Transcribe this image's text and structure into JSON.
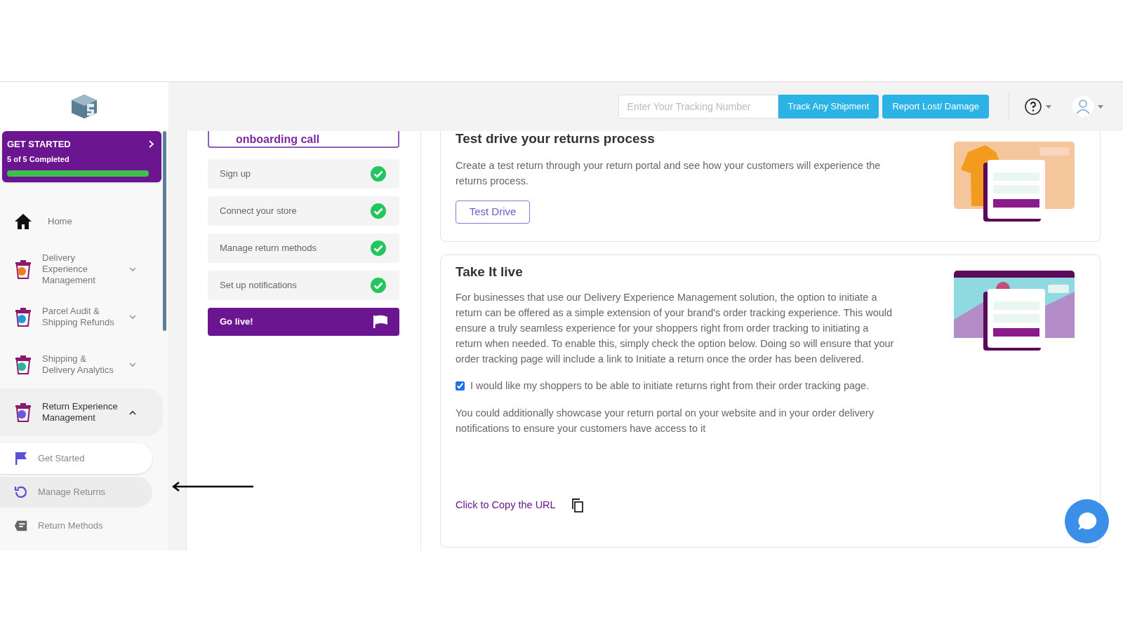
{
  "header": {
    "tracking_placeholder": "Enter Your Tracking Number",
    "track_button": "Track Any Shipment",
    "report_button": "Report Lost/ Damage"
  },
  "get_started": {
    "title": "GET STARTED",
    "progress_text": "5 of 5 Completed",
    "level": 1
  },
  "nav": [
    {
      "label": "Home",
      "kind": "home"
    },
    {
      "label": "Delivery Experience Management",
      "kind": "group",
      "color": "#f07c1e",
      "expanded": false
    },
    {
      "label": "Parcel Audit & Shipping Refunds",
      "kind": "group",
      "color": "#1e9be0",
      "expanded": false
    },
    {
      "label": "Shipping & Delivery Analytics",
      "kind": "group",
      "color": "#2bb59a",
      "expanded": false
    },
    {
      "label": "Return Experience Management",
      "kind": "group",
      "color": "#6a5ae0",
      "expanded": true,
      "children": [
        {
          "label": "Get Started",
          "kind": "flag",
          "selected": true,
          "hovered": false
        },
        {
          "label": "Manage Returns",
          "kind": "return",
          "selected": false,
          "hovered": true
        },
        {
          "label": "Return Methods",
          "kind": "tag",
          "selected": false,
          "hovered": false
        }
      ]
    }
  ],
  "onboarding": {
    "title": "onboarding call",
    "steps": [
      {
        "label": "Sign up",
        "done": true
      },
      {
        "label": "Connect your store",
        "done": true
      },
      {
        "label": "Manage return methods",
        "done": true
      },
      {
        "label": "Set up notifications",
        "done": true
      }
    ],
    "go_live": "Go live!"
  },
  "test_drive": {
    "title": "Test drive your returns process",
    "text": "Create a test return through your return portal and see how your customers will experience the returns process.",
    "button": "Test Drive"
  },
  "take_live": {
    "title": "Take It live",
    "text": "For businesses that use our Delivery Experience Management solution, the option to initiate a return can be offered as a simple extension of your brand's order tracking experience. This would ensure a truly seamless experience for your shoppers right from order tracking to initiating a return when needed. To enable this, simply check the option below. Doing so will ensure that your order tracking page will include a link to Initiate a return once the order has been delivered.",
    "checkbox": {
      "label": "I would like my shoppers to be able to initiate returns right from their order tracking page.",
      "checked": true
    },
    "note": "You could additionally showcase your return portal on your website and in your order delivery notifications to ensure your customers have access to it",
    "copy_link": "Click to Copy the URL"
  }
}
